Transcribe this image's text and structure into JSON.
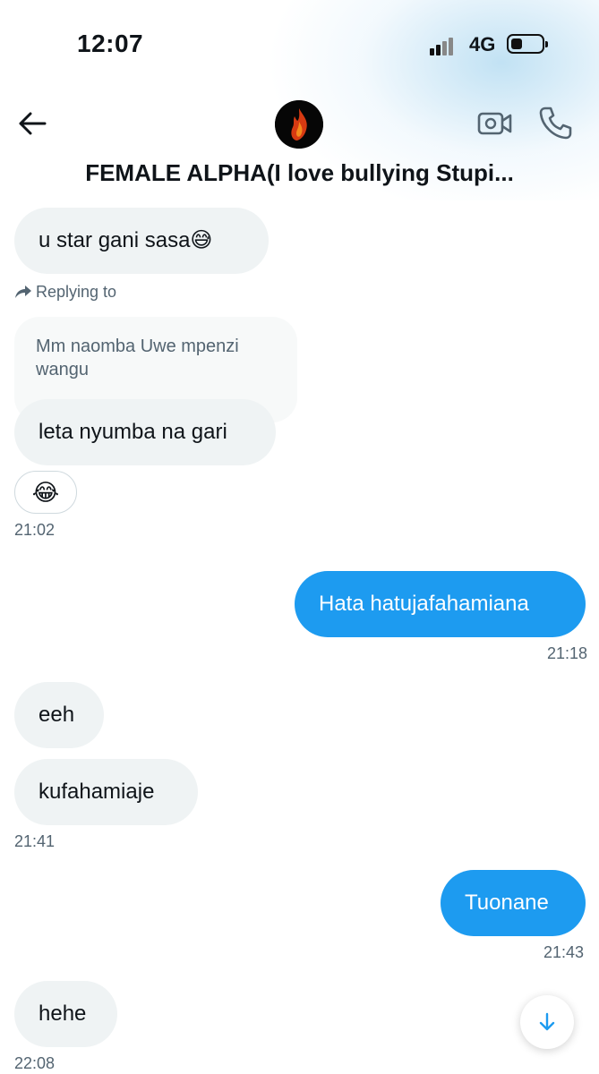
{
  "status_bar": {
    "time": "12:07",
    "network": "4G"
  },
  "header": {
    "title": "FEMALE ALPHA(I love bullying Stupi..."
  },
  "messages": [
    {
      "text": "u star gani sasa😅"
    },
    {
      "replying_label": "Replying to",
      "quoted_text": "Mm naomba Uwe mpenzi wangu"
    },
    {
      "text": "leta nyumba na gari"
    },
    {
      "reaction": "😂",
      "time": "21:02"
    },
    {
      "text": "Hata hatujafahamiana",
      "time": "21:18"
    },
    {
      "text": "eeh"
    },
    {
      "text": "kufahamiaje",
      "time": "21:41"
    },
    {
      "text": "Tuonane",
      "time": "21:43"
    },
    {
      "text": "hehe",
      "time": "22:08"
    }
  ],
  "colors": {
    "outgoing": "#1d9bf0",
    "incoming": "#eff3f4",
    "muted": "#536471"
  },
  "icons": [
    "back-arrow-icon",
    "video-call-icon",
    "phone-icon",
    "replying-arrow-icon",
    "scroll-down-arrow-icon"
  ]
}
